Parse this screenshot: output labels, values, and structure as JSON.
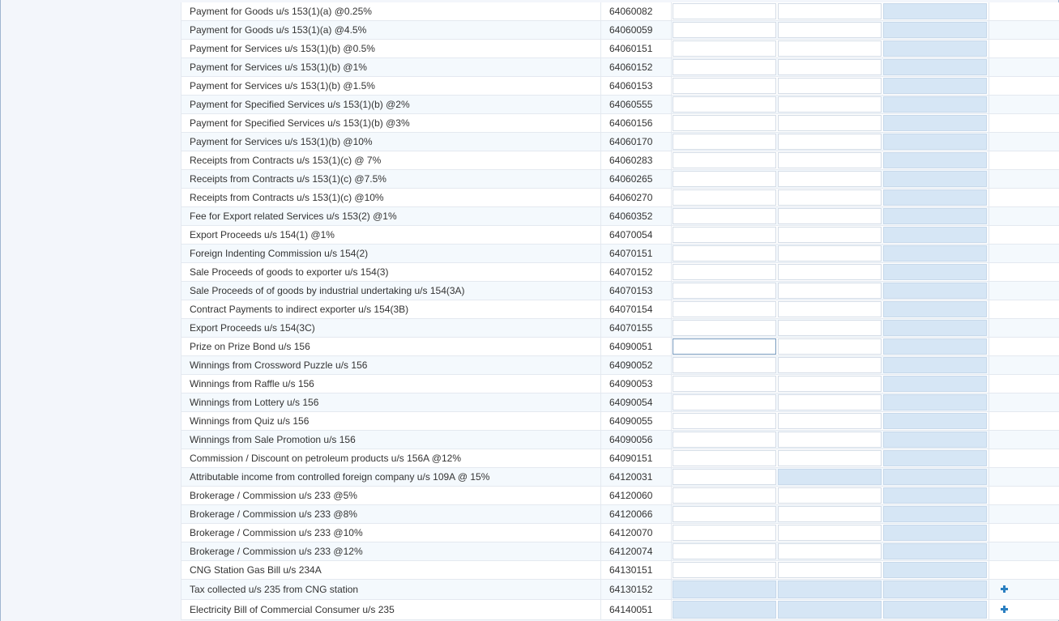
{
  "table": {
    "rows": [
      {
        "desc": "Payment for Goods u/s 153(1)(a) @0.25%",
        "code": "64060082",
        "in1": "enabled",
        "in2": "enabled",
        "in3": "disabled"
      },
      {
        "desc": "Payment for Goods u/s 153(1)(a) @4.5%",
        "code": "64060059",
        "in1": "enabled",
        "in2": "enabled",
        "in3": "disabled"
      },
      {
        "desc": "Payment for Services u/s 153(1)(b) @0.5%",
        "code": "64060151",
        "in1": "enabled",
        "in2": "enabled",
        "in3": "disabled"
      },
      {
        "desc": "Payment for Services u/s 153(1)(b) @1%",
        "code": "64060152",
        "in1": "enabled",
        "in2": "enabled",
        "in3": "disabled"
      },
      {
        "desc": "Payment for Services u/s 153(1)(b) @1.5%",
        "code": "64060153",
        "in1": "enabled",
        "in2": "enabled",
        "in3": "disabled"
      },
      {
        "desc": "Payment for Specified Services u/s 153(1)(b) @2%",
        "code": "64060555",
        "in1": "enabled",
        "in2": "enabled",
        "in3": "disabled"
      },
      {
        "desc": "Payment for Specified Services u/s 153(1)(b) @3%",
        "code": "64060156",
        "in1": "enabled",
        "in2": "enabled",
        "in3": "disabled"
      },
      {
        "desc": "Payment for Services u/s 153(1)(b) @10%",
        "code": "64060170",
        "in1": "enabled",
        "in2": "enabled",
        "in3": "disabled"
      },
      {
        "desc": "Receipts from Contracts u/s 153(1)(c) @ 7%",
        "code": "64060283",
        "in1": "enabled",
        "in2": "enabled",
        "in3": "disabled"
      },
      {
        "desc": "Receipts from Contracts u/s 153(1)(c) @7.5%",
        "code": "64060265",
        "in1": "enabled",
        "in2": "enabled",
        "in3": "disabled"
      },
      {
        "desc": "Receipts from Contracts u/s 153(1)(c) @10%",
        "code": "64060270",
        "in1": "enabled",
        "in2": "enabled",
        "in3": "disabled"
      },
      {
        "desc": "Fee for Export related Services u/s 153(2) @1%",
        "code": "64060352",
        "in1": "enabled",
        "in2": "enabled",
        "in3": "disabled"
      },
      {
        "desc": "Export Proceeds u/s 154(1) @1%",
        "code": "64070054",
        "in1": "enabled",
        "in2": "enabled",
        "in3": "disabled"
      },
      {
        "desc": "Foreign Indenting Commission u/s 154(2)",
        "code": "64070151",
        "in1": "enabled",
        "in2": "enabled",
        "in3": "disabled"
      },
      {
        "desc": "Sale Proceeds of goods to exporter u/s 154(3)",
        "code": "64070152",
        "in1": "enabled",
        "in2": "enabled",
        "in3": "disabled"
      },
      {
        "desc": "Sale Proceeds of of goods by industrial undertaking u/s 154(3A)",
        "code": "64070153",
        "in1": "enabled",
        "in2": "enabled",
        "in3": "disabled"
      },
      {
        "desc": "Contract Payments to indirect exporter u/s 154(3B)",
        "code": "64070154",
        "in1": "enabled",
        "in2": "enabled",
        "in3": "disabled"
      },
      {
        "desc": "Export Proceeds u/s 154(3C)",
        "code": "64070155",
        "in1": "enabled",
        "in2": "enabled",
        "in3": "disabled"
      },
      {
        "desc": "Prize on Prize Bond u/s 156",
        "code": "64090051",
        "in1": "focused",
        "in2": "enabled",
        "in3": "disabled"
      },
      {
        "desc": "Winnings from Crossword Puzzle u/s 156",
        "code": "64090052",
        "in1": "enabled",
        "in2": "enabled",
        "in3": "disabled"
      },
      {
        "desc": "Winnings from Raffle u/s 156",
        "code": "64090053",
        "in1": "enabled",
        "in2": "enabled",
        "in3": "disabled"
      },
      {
        "desc": "Winnings from Lottery u/s 156",
        "code": "64090054",
        "in1": "enabled",
        "in2": "enabled",
        "in3": "disabled"
      },
      {
        "desc": "Winnings from Quiz u/s 156",
        "code": "64090055",
        "in1": "enabled",
        "in2": "enabled",
        "in3": "disabled"
      },
      {
        "desc": "Winnings from Sale Promotion u/s 156",
        "code": "64090056",
        "in1": "enabled",
        "in2": "enabled",
        "in3": "disabled"
      },
      {
        "desc": "Commission / Discount on petroleum products u/s 156A @12%",
        "code": "64090151",
        "in1": "enabled",
        "in2": "enabled",
        "in3": "disabled"
      },
      {
        "desc": "Attributable income from controlled foreign company u/s 109A @ 15%",
        "code": "64120031",
        "in1": "enabled",
        "in2": "disabled",
        "in3": "disabled"
      },
      {
        "desc": "Brokerage / Commission u/s 233 @5%",
        "code": "64120060",
        "in1": "enabled",
        "in2": "enabled",
        "in3": "disabled"
      },
      {
        "desc": "Brokerage / Commission u/s 233 @8%",
        "code": "64120066",
        "in1": "enabled",
        "in2": "enabled",
        "in3": "disabled"
      },
      {
        "desc": "Brokerage / Commission u/s 233 @10%",
        "code": "64120070",
        "in1": "enabled",
        "in2": "enabled",
        "in3": "disabled"
      },
      {
        "desc": "Brokerage / Commission u/s 233 @12%",
        "code": "64120074",
        "in1": "enabled",
        "in2": "enabled",
        "in3": "disabled"
      },
      {
        "desc": "CNG Station Gas Bill u/s 234A",
        "code": "64130151",
        "in1": "enabled",
        "in2": "enabled",
        "in3": "disabled"
      },
      {
        "desc": "Tax collected u/s 235 from CNG station",
        "code": "64130152",
        "in1": "disabled",
        "in2": "disabled",
        "in3": "disabled",
        "add": true
      },
      {
        "desc": "Electricity Bill of Commercial Consumer u/s 235",
        "code": "64140051",
        "in1": "disabled",
        "in2": "disabled",
        "in3": "disabled",
        "add": true
      }
    ]
  },
  "colors": {
    "disabled_fill": "#d6e6f5",
    "add_icon": "#2a7fc1"
  },
  "icons": {
    "add": "plus-icon"
  }
}
